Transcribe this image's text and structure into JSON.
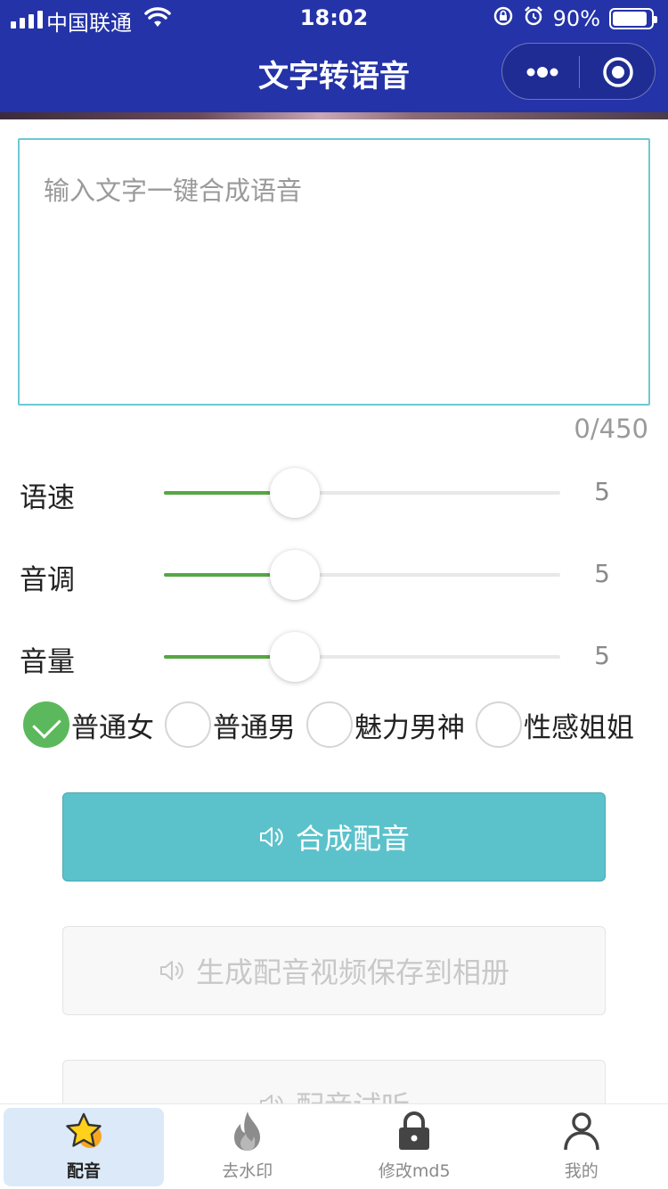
{
  "status_bar": {
    "carrier": "中国联通",
    "time": "18:02",
    "battery": "90%",
    "battery_level": 0.9
  },
  "nav": {
    "title": "文字转语音",
    "more_icon": "more-dots-icon",
    "close_icon": "target-icon"
  },
  "editor": {
    "placeholder": "输入文字一键合成语音",
    "value": "",
    "counter": "0/450"
  },
  "sliders": [
    {
      "label": "语速",
      "value": "5",
      "fraction": 0.33
    },
    {
      "label": "音调",
      "value": "5",
      "fraction": 0.33
    },
    {
      "label": "音量",
      "value": "5",
      "fraction": 0.33
    }
  ],
  "voices": [
    {
      "label": "普通女",
      "checked": true
    },
    {
      "label": "普通男",
      "checked": false
    },
    {
      "label": "魅力男神",
      "checked": false
    },
    {
      "label": "性感姐姐",
      "checked": false
    }
  ],
  "buttons": {
    "synthesize": "合成配音",
    "save_video": "生成配音视频保存到相册",
    "preview": "配音试听"
  },
  "tabs": [
    {
      "label": "配音",
      "icon": "star-icon",
      "active": true
    },
    {
      "label": "去水印",
      "icon": "flame-icon",
      "active": false
    },
    {
      "label": "修改md5",
      "icon": "lock-icon",
      "active": false
    },
    {
      "label": "我的",
      "icon": "person-icon",
      "active": false
    }
  ],
  "colors": {
    "nav_bg": "#2433a8",
    "accent": "#5bc2cb",
    "slider_active": "#56a744",
    "radio_checked": "#5cb85c"
  }
}
